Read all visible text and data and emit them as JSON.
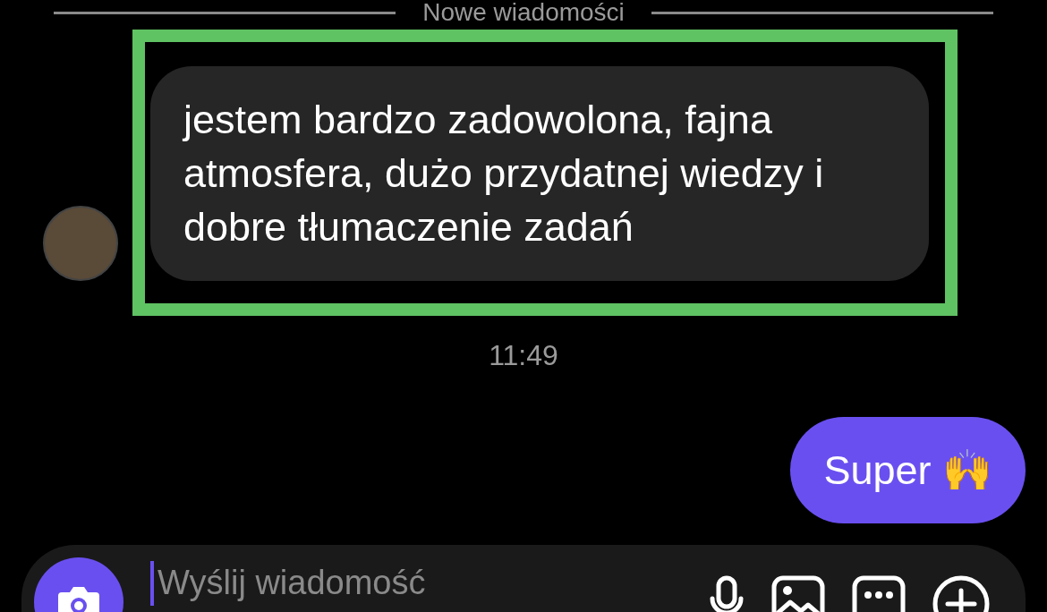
{
  "divider": {
    "label": "Nowe wiadomości"
  },
  "messages": [
    {
      "kind": "received",
      "text": "jestem bardzo zadowolona, fajna atmosfera, dużo przydatnej wiedzy i dobre tłumaczenie zadań",
      "highlighted": true
    },
    {
      "kind": "time",
      "text": "11:49"
    },
    {
      "kind": "sent",
      "text": "Super 🙌"
    }
  ],
  "composer": {
    "placeholder": "Wyślij wiadomość"
  }
}
